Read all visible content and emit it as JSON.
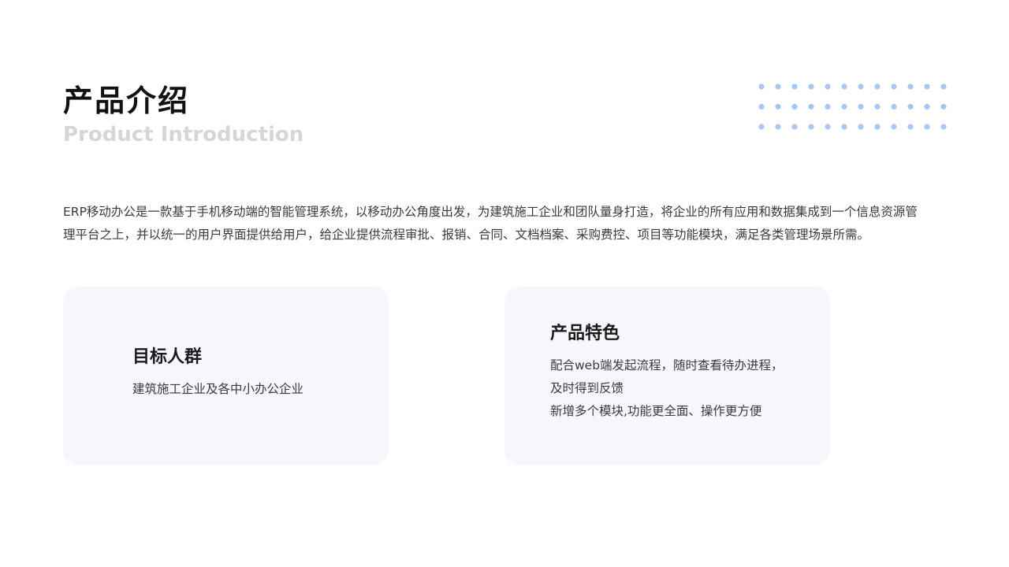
{
  "header": {
    "title": "产品介绍",
    "subtitle": "Product Introduction"
  },
  "intro": {
    "line1": "ERP移动办公是一款基于手机移动端的智能管理系统，以移动办公角度出发，为建筑施工企业和团队量身打造，将企业的所有应用和数据集成到一个信息资源管",
    "line2": "理平台之上，并以统一的用户界面提供给用户，给企业提供流程审批、报销、合同、文档档案、采购费控、项目等功能模块，满足各类管理场景所需。"
  },
  "cards": [
    {
      "title": "目标人群",
      "lines": [
        "建筑施工企业及各中小办公企业"
      ]
    },
    {
      "title": "产品特色",
      "lines": [
        "配合web端发起流程，随时查看待办进程，",
        "及时得到反馈",
        "新增多个模块,功能更全面、操作更方便"
      ]
    }
  ],
  "decoration": {
    "dot_color": "#a7c8f7",
    "card_bg": "#f6f7fd"
  }
}
